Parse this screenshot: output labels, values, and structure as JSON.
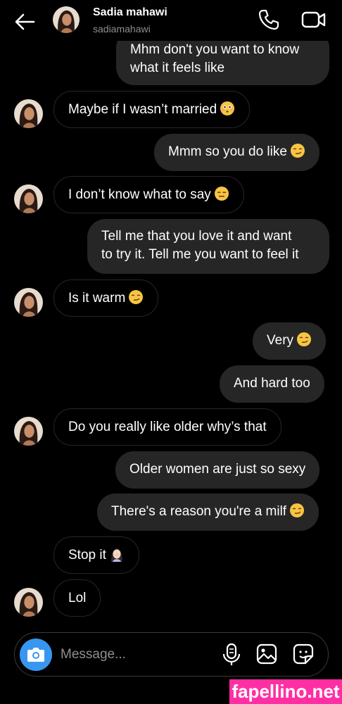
{
  "header": {
    "name": "Sadia mahawi",
    "username": "sadiamahawi"
  },
  "messages": [
    {
      "text": "Mhm don't you want to know",
      "text2": "what it feels like",
      "side": "out"
    },
    {
      "text": "Maybe if I wasn’t married",
      "side": "in",
      "emoji": "flushed-face"
    },
    {
      "text": "Mmm so you do like",
      "side": "out",
      "emoji": "smirking-face"
    },
    {
      "text": "I don’t know what to say",
      "side": "in",
      "emoji": "expressionless-face"
    },
    {
      "text": "Tell me that you love it and want",
      "text2": "to try it. Tell me you want to feel it",
      "side": "out"
    },
    {
      "text": "Is it warm",
      "side": "in",
      "emoji": "smirking-face"
    },
    {
      "text": "Very",
      "side": "out",
      "emoji": "smirking-face"
    },
    {
      "text": "And hard too",
      "side": "out"
    },
    {
      "text": "Do you really like older why’s that",
      "side": "in"
    },
    {
      "text": "Older women are just so sexy",
      "side": "out"
    },
    {
      "text": "There's a reason you're a milf",
      "side": "out",
      "emoji": "smirking-face"
    },
    {
      "text": "Stop it",
      "side": "in",
      "emoji": "facepalm-woman"
    },
    {
      "text": "Lol",
      "side": "in"
    }
  ],
  "composer": {
    "placeholder": "Message..."
  },
  "watermark": "fapellino.net",
  "colors": {
    "accent": "#3797f0",
    "outgoing_bubble": "#262626",
    "background": "#000000",
    "watermark": "#ff2fa3"
  }
}
